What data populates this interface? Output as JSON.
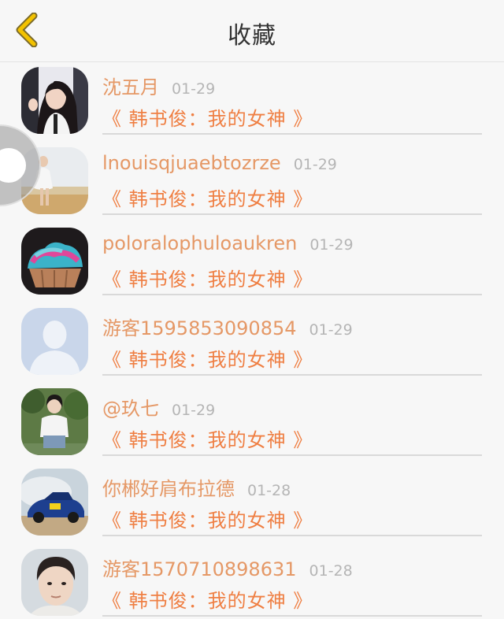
{
  "header": {
    "title": "收藏",
    "back_icon": "chevron-left-icon",
    "accent_color": "#f3c200"
  },
  "colors": {
    "username": "#e59866",
    "work_title": "#ef7f43",
    "date": "#b5b5b5"
  },
  "favorites": [
    {
      "username": "沈五月",
      "date": "01-29",
      "work_title": "《 韩书俊：我的女神 》",
      "avatar": "girl-portrait-avatar"
    },
    {
      "username": "lnouisqjuaebtozrze",
      "date": "01-29",
      "work_title": "《 韩书俊：我的女神 》",
      "avatar": "girl-in-field-avatar"
    },
    {
      "username": "poloralophuloaukren",
      "date": "01-29",
      "work_title": "《 韩书俊：我的女神 》",
      "avatar": "cupcake-avatar"
    },
    {
      "username": "游客1595853090854",
      "date": "01-29",
      "work_title": "《 韩书俊：我的女神 》",
      "avatar": "default-person-avatar"
    },
    {
      "username": "@玖七",
      "date": "01-29",
      "work_title": "《 韩书俊：我的女神 》",
      "avatar": "girl-outdoor-avatar"
    },
    {
      "username": "你郴好肩布拉德",
      "date": "01-28",
      "work_title": "《 韩书俊：我的女神 》",
      "avatar": "rally-car-avatar"
    },
    {
      "username": "游客1570710898631",
      "date": "01-28",
      "work_title": "《 韩书俊：我的女神 》",
      "avatar": "boy-portrait-avatar"
    }
  ]
}
